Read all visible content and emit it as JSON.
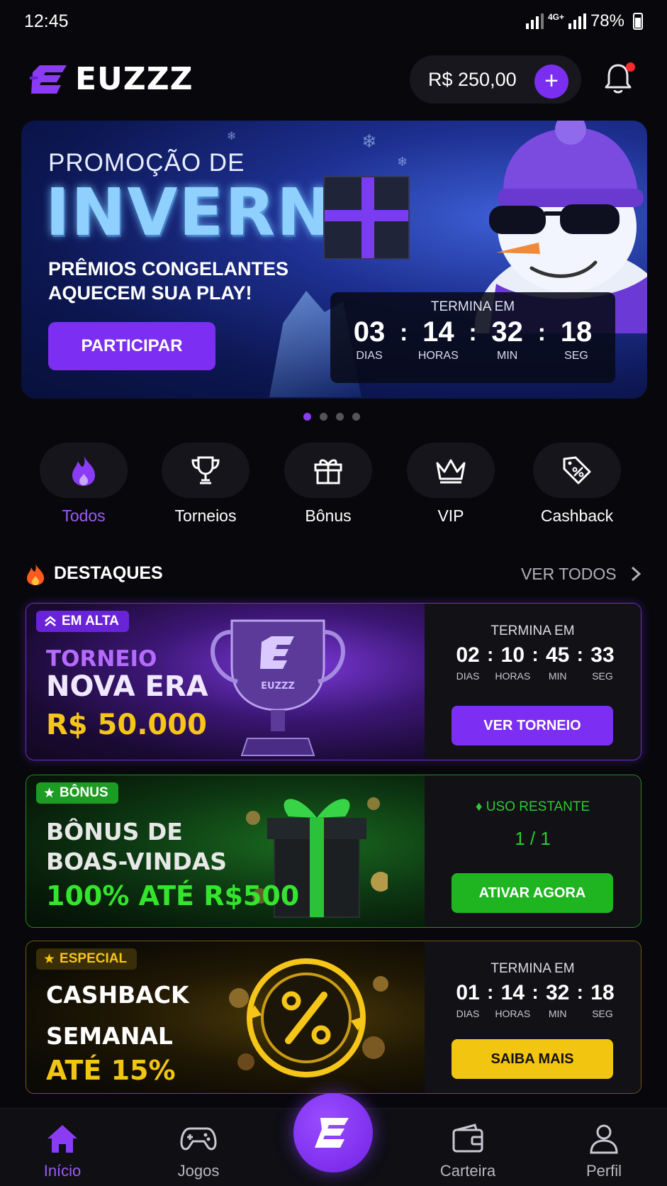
{
  "status_bar": {
    "time": "12:45",
    "network": "4G+",
    "battery": "78%"
  },
  "header": {
    "brand": "EUZZZ",
    "balance": "R$ 250,00",
    "add_label": "+"
  },
  "banner": {
    "pretitle": "PROMOÇÃO DE",
    "title": "INVERNO",
    "subtitle_line1": "PRÊMIOS CONGELANTES",
    "subtitle_line2": "AQUECEM SUA PLAY!",
    "cta": "PARTICIPAR",
    "timer_label": "TERMINA EM",
    "timer": [
      {
        "value": "03",
        "unit": "DIAS"
      },
      {
        "value": "14",
        "unit": "HORAS"
      },
      {
        "value": "32",
        "unit": "MIN"
      },
      {
        "value": "18",
        "unit": "SEG"
      }
    ],
    "slides_total": 4,
    "active_slide": 1
  },
  "categories": [
    {
      "label": "Todos",
      "icon": "flame-icon",
      "active": true
    },
    {
      "label": "Torneios",
      "icon": "trophy-icon",
      "active": false
    },
    {
      "label": "Bônus",
      "icon": "gift-icon",
      "active": false
    },
    {
      "label": "VIP",
      "icon": "crown-icon",
      "active": false
    },
    {
      "label": "Cashback",
      "icon": "discount-tag-icon",
      "active": false
    }
  ],
  "section": {
    "title": "DESTAQUES",
    "see_all": "VER TODOS"
  },
  "cards": {
    "tournament": {
      "badge": "EM ALTA",
      "line1": "TORNEIO",
      "line2": "NOVA ERA",
      "line3": "R$ 50.000",
      "trophy_text": "EUZZZ",
      "timer_label": "TERMINA EM",
      "timer": [
        {
          "value": "02",
          "unit": "DIAS"
        },
        {
          "value": "10",
          "unit": "HORAS"
        },
        {
          "value": "45",
          "unit": "MIN"
        },
        {
          "value": "33",
          "unit": "SEG"
        }
      ],
      "cta": "VER TORNEIO"
    },
    "bonus": {
      "badge": "BÔNUS",
      "line1": "BÔNUS DE",
      "line2": "BOAS-VINDAS",
      "line3": "100% ATÉ R$500",
      "usage_label": "USO RESTANTE",
      "usage_value": "1 / 1",
      "cta": "ATIVAR AGORA"
    },
    "cashback": {
      "badge": "ESPECIAL",
      "line1": "CASHBACK",
      "line2": "SEMANAL",
      "line3": "ATÉ 15%",
      "timer_label": "TERMINA EM",
      "timer": [
        {
          "value": "01",
          "unit": "DIAS"
        },
        {
          "value": "14",
          "unit": "HORAS"
        },
        {
          "value": "32",
          "unit": "MIN"
        },
        {
          "value": "18",
          "unit": "SEG"
        }
      ],
      "cta": "SAIBA MAIS"
    }
  },
  "bottom_nav": [
    {
      "label": "Início",
      "icon": "home-icon",
      "active": true
    },
    {
      "label": "Jogos",
      "icon": "gamepad-icon",
      "active": false
    },
    {
      "label": "Carteira",
      "icon": "wallet-icon",
      "active": false
    },
    {
      "label": "Perfil",
      "icon": "user-icon",
      "active": false
    }
  ],
  "colors": {
    "accent": "#7c2ff2",
    "bonus_green": "#1fb521",
    "cashback_gold": "#f2c511",
    "tournament_gold": "#f5c518"
  }
}
